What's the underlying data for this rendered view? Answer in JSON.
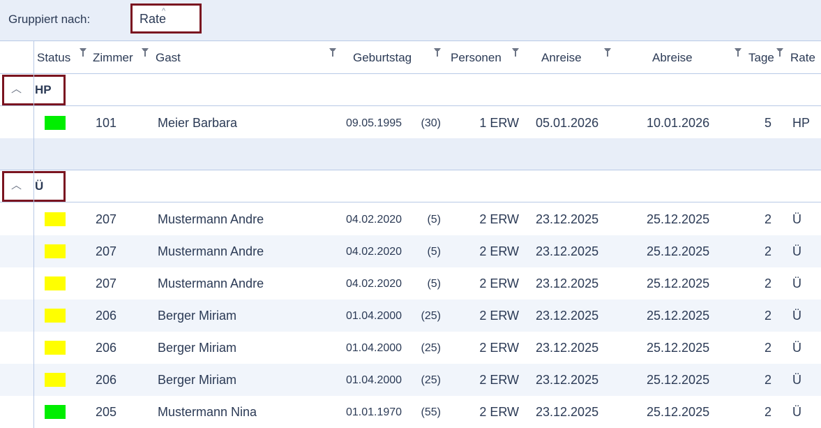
{
  "groupbar": {
    "label": "Gruppiert nach:",
    "chip": "Rate"
  },
  "columns": {
    "status": "Status",
    "zimmer": "Zimmer",
    "gast": "Gast",
    "geburtstag": "Geburtstag",
    "personen": "Personen",
    "anreise": "Anreise",
    "abreise": "Abreise",
    "tage": "Tage",
    "rate": "Rate"
  },
  "status_colors": {
    "green": "#00ee00",
    "yellow": "#ffff00"
  },
  "groups": [
    {
      "name": "HP",
      "rows": [
        {
          "status": "green",
          "zimmer": "101",
          "gast": "Meier Barbara",
          "geburtstag": "09.05.1995",
          "alter": "(30)",
          "personen": "1 ERW",
          "anreise": "05.01.2026",
          "abreise": "10.01.2026",
          "tage": "5",
          "rate": "HP"
        }
      ]
    },
    {
      "name": "Ü",
      "rows": [
        {
          "status": "yellow",
          "zimmer": "207",
          "gast": "Mustermann Andre",
          "geburtstag": "04.02.2020",
          "alter": "(5)",
          "personen": "2 ERW",
          "anreise": "23.12.2025",
          "abreise": "25.12.2025",
          "tage": "2",
          "rate": "Ü"
        },
        {
          "status": "yellow",
          "zimmer": "207",
          "gast": "Mustermann Andre",
          "geburtstag": "04.02.2020",
          "alter": "(5)",
          "personen": "2 ERW",
          "anreise": "23.12.2025",
          "abreise": "25.12.2025",
          "tage": "2",
          "rate": "Ü"
        },
        {
          "status": "yellow",
          "zimmer": "207",
          "gast": "Mustermann Andre",
          "geburtstag": "04.02.2020",
          "alter": "(5)",
          "personen": "2 ERW",
          "anreise": "23.12.2025",
          "abreise": "25.12.2025",
          "tage": "2",
          "rate": "Ü"
        },
        {
          "status": "yellow",
          "zimmer": "206",
          "gast": "Berger Miriam",
          "geburtstag": "01.04.2000",
          "alter": "(25)",
          "personen": "2 ERW",
          "anreise": "23.12.2025",
          "abreise": "25.12.2025",
          "tage": "2",
          "rate": "Ü"
        },
        {
          "status": "yellow",
          "zimmer": "206",
          "gast": "Berger Miriam",
          "geburtstag": "01.04.2000",
          "alter": "(25)",
          "personen": "2 ERW",
          "anreise": "23.12.2025",
          "abreise": "25.12.2025",
          "tage": "2",
          "rate": "Ü"
        },
        {
          "status": "yellow",
          "zimmer": "206",
          "gast": "Berger Miriam",
          "geburtstag": "01.04.2000",
          "alter": "(25)",
          "personen": "2 ERW",
          "anreise": "23.12.2025",
          "abreise": "25.12.2025",
          "tage": "2",
          "rate": "Ü"
        },
        {
          "status": "green",
          "zimmer": "205",
          "gast": "Mustermann Nina",
          "geburtstag": "01.01.1970",
          "alter": "(55)",
          "personen": "2 ERW",
          "anreise": "23.12.2025",
          "abreise": "25.12.2025",
          "tage": "2",
          "rate": "Ü"
        }
      ]
    }
  ]
}
